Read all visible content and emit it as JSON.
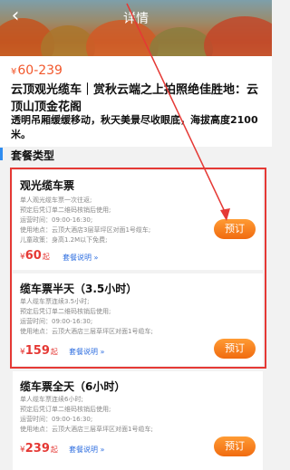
{
  "header": {
    "back_icon": "back-arrow-icon",
    "title": "详情"
  },
  "summary": {
    "currency": "¥",
    "price_range": "60-239",
    "headline": "云顶观光缆车｜赏秋云端之上拍照绝佳胜地：云顶山顶金花阁",
    "subline": "透明吊厢缓缓移动，秋天美景尽收眼底，海拔高度2100米。"
  },
  "packages_section": {
    "title": "套餐类型",
    "items": [
      {
        "name": "观光缆车票",
        "lines": [
          "单人观光缆车票一次往返;",
          "预定后凭订单二维码核销后使用;",
          "运营时间：09:00-16:30;",
          "使用地点：云顶大酒店3层草坪区对面1号缆车;",
          "儿童政策：身高1.2M以下免费;"
        ],
        "currency": "¥",
        "price": "60",
        "price_suffix": "起",
        "note": "套餐说明 »",
        "button": "预订"
      },
      {
        "name": "缆车票半天（3.5小时）",
        "lines": [
          "单人缆车票连续3.5小时;",
          "预定后凭订单二维码核销后使用;",
          "运营时间：09:00-16:30;",
          "使用地点：云顶大酒店三层草坪区对面1号缆车;"
        ],
        "currency": "¥",
        "price": "159",
        "price_suffix": "起",
        "note": "套餐说明 »",
        "button": "预订"
      },
      {
        "name": "缆车票全天（6小时）",
        "lines": [
          "单人缆车票连续6小时;",
          "预定后凭订单二维码核销后使用;",
          "运营时间：09:00-16:30;",
          "使用地点：云顶大酒店三层草坪区对面1号缆车;"
        ],
        "currency": "¥",
        "price": "239",
        "price_suffix": "起",
        "note": "套餐说明 »",
        "button": "预订"
      }
    ]
  },
  "colors": {
    "accent_orange": "#f06b10",
    "price_red": "#e53935",
    "highlight_box": "#e53935",
    "link_blue": "#2f6fe0"
  }
}
